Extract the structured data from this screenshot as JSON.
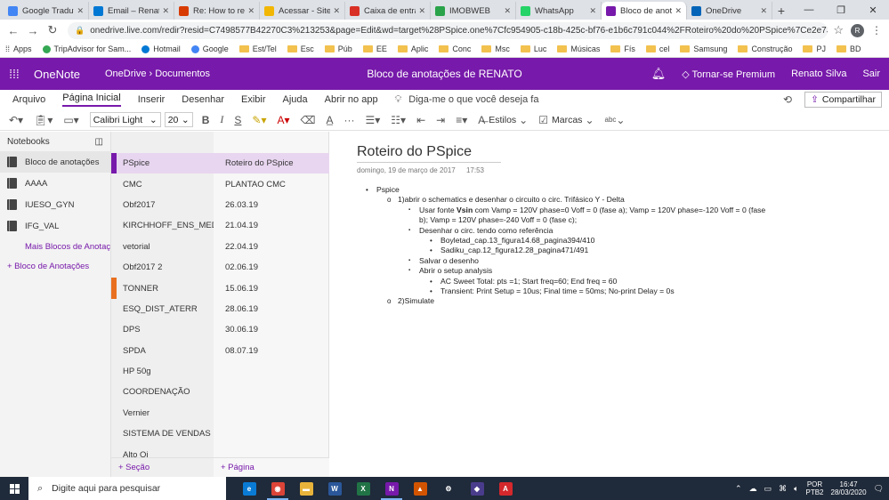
{
  "browser": {
    "tabs": [
      {
        "title": "Google Tradutor",
        "color": "#4285f4",
        "active": false
      },
      {
        "title": "Email – Renato",
        "color": "#0078d4",
        "active": false
      },
      {
        "title": "Re: How to recu",
        "color": "#d83b01",
        "active": false
      },
      {
        "title": "Acessar - Site c",
        "color": "#f2b705",
        "active": false
      },
      {
        "title": "Caixa de entrad",
        "color": "#d93025",
        "active": false
      },
      {
        "title": "IMOBWEB",
        "color": "#2aa34a",
        "active": false
      },
      {
        "title": "WhatsApp",
        "color": "#25d366",
        "active": false
      },
      {
        "title": "Bloco de anotaç",
        "color": "#7719aa",
        "active": true
      },
      {
        "title": "OneDrive",
        "color": "#0364b8",
        "active": false
      }
    ],
    "url": "onedrive.live.com/redir?resid=C7498577B42270C3%213253&page=Edit&wd=target%28PSpice.one%7Cfc954905-c18b-425c-bf76-e1b6c791c044%2FRoteiro%20do%20PSpice%7Ce2e7392d-4cba...",
    "profile_initial": "R",
    "bookmarks": [
      {
        "label": "Apps",
        "type": "apps"
      },
      {
        "label": "TripAdvisor for Sam...",
        "type": "site",
        "color": "#34a853"
      },
      {
        "label": "Hotmail",
        "type": "site",
        "color": "#0078d4"
      },
      {
        "label": "Google",
        "type": "site",
        "color": "#4285f4"
      },
      {
        "label": "Est/Tel",
        "type": "folder"
      },
      {
        "label": "Esc",
        "type": "folder"
      },
      {
        "label": "Púb",
        "type": "folder"
      },
      {
        "label": "EE",
        "type": "folder"
      },
      {
        "label": "Aplic",
        "type": "folder"
      },
      {
        "label": "Conc",
        "type": "folder"
      },
      {
        "label": "Msc",
        "type": "folder"
      },
      {
        "label": "Luc",
        "type": "folder"
      },
      {
        "label": "Músicas",
        "type": "folder"
      },
      {
        "label": "Fís",
        "type": "folder"
      },
      {
        "label": "cel",
        "type": "folder"
      },
      {
        "label": "Samsung",
        "type": "folder"
      },
      {
        "label": "Construção",
        "type": "folder"
      },
      {
        "label": "PJ",
        "type": "folder"
      },
      {
        "label": "BD",
        "type": "folder"
      }
    ]
  },
  "onenote": {
    "app_name": "OneNote",
    "breadcrumb": "OneDrive › Documentos",
    "notebook_title": "Bloco de anotações de RENATO",
    "premium": "Tornar-se Premium",
    "user": "Renato Silva",
    "signout": "Sair",
    "ribbon_tabs": [
      "Arquivo",
      "Página Inicial",
      "Inserir",
      "Desenhar",
      "Exibir",
      "Ajuda",
      "Abrir no app"
    ],
    "tellme": "Diga-me o que você deseja fa",
    "share": "Compartilhar",
    "font": "Calibri Light",
    "font_size": "20",
    "bold": "B",
    "italic": "I",
    "underline": "S",
    "styles": "Estilos",
    "tags": "Marcas",
    "spell": "abc"
  },
  "notebooks": {
    "header": "Notebooks",
    "items": [
      "Bloco de anotações",
      "AAAA",
      "IUESO_GYN",
      "IFG_VAL"
    ],
    "more": "Mais Blocos de Anotaç",
    "add": "+ Bloco de Anotações"
  },
  "sections": {
    "items": [
      {
        "label": "PSpice",
        "color": "#7719aa",
        "selected": true
      },
      {
        "label": "CMC",
        "color": "",
        "selected": false
      },
      {
        "label": "Obf2017",
        "color": "",
        "selected": false
      },
      {
        "label": "KIRCHHOFF_ENS_MED...",
        "color": "",
        "selected": false
      },
      {
        "label": "vetorial",
        "color": "",
        "selected": false
      },
      {
        "label": "Obf2017 2",
        "color": "",
        "selected": false
      },
      {
        "label": "TONNER",
        "color": "#e86f1f",
        "selected": false
      },
      {
        "label": "ESQ_DIST_ATERR",
        "color": "",
        "selected": false
      },
      {
        "label": "DPS",
        "color": "",
        "selected": false
      },
      {
        "label": "SPDA",
        "color": "",
        "selected": false
      },
      {
        "label": "HP 50g",
        "color": "",
        "selected": false
      },
      {
        "label": "COORDENAÇÃO",
        "color": "",
        "selected": false
      },
      {
        "label": "Vernier",
        "color": "",
        "selected": false
      },
      {
        "label": "SISTEMA DE VENDAS",
        "color": "",
        "selected": false
      },
      {
        "label": "Alto Oi",
        "color": "",
        "selected": false
      }
    ],
    "add": "+ Seção"
  },
  "pages": {
    "items": [
      {
        "label": "Roteiro do PSpice",
        "selected": true
      },
      {
        "label": "PLANTAO CMC",
        "selected": false
      },
      {
        "label": "26.03.19",
        "selected": false
      },
      {
        "label": "21.04.19",
        "selected": false
      },
      {
        "label": "22.04.19",
        "selected": false
      },
      {
        "label": "02.06.19",
        "selected": false
      },
      {
        "label": "15.06.19",
        "selected": false
      },
      {
        "label": "28.06.19",
        "selected": false
      },
      {
        "label": "30.06.19",
        "selected": false
      },
      {
        "label": "08.07.19",
        "selected": false
      }
    ],
    "add": "+ Página"
  },
  "page": {
    "title": "Roteiro do PSpice",
    "date": "domingo, 19 de março de 2017",
    "time": "17:53",
    "lines": [
      {
        "level": 0,
        "bullet": "•",
        "text": "Pspice"
      },
      {
        "level": 1,
        "bullet": "o",
        "text": "1)abrir o schematics e desenhar o circuito o circ. Trifásico Y - Delta"
      },
      {
        "level": 2,
        "bullet": "▪",
        "pre": "Usar fonte ",
        "bold": "Vsin",
        "text": " com Vamp = 120V phase=0  Voff = 0 (fase a); Vamp = 120V phase=-120  Voff = 0 (fase"
      },
      {
        "level": 2,
        "bullet": "",
        "text": "b); Vamp = 120V phase=-240  Voff = 0 (fase c);"
      },
      {
        "level": 2,
        "bullet": "▪",
        "text": "Desenhar o circ. tendo como referência"
      },
      {
        "level": 3,
        "bullet": "•",
        "text": "Boyletad_cap.13_figura14.68_pagina394/410"
      },
      {
        "level": 3,
        "bullet": "•",
        "text": "Sadiku_cap.12_figura12.28_pagina471/491"
      },
      {
        "level": 2,
        "bullet": "▪",
        "text": "Salvar o desenho"
      },
      {
        "level": 2,
        "bullet": "▪",
        "text": "Abrir o setup analysis"
      },
      {
        "level": 3,
        "bullet": "•",
        "text": " AC Sweet Total: pts =1; Start freq=60; End freq = 60"
      },
      {
        "level": 3,
        "bullet": "•",
        "text": "Transient: Print Setup = 10us; Final time = 50ms; No-print Delay = 0s"
      },
      {
        "level": 1,
        "bullet": "o",
        "text": "2)Simulate"
      }
    ]
  },
  "taskbar": {
    "search": "Digite aqui para pesquisar",
    "apps": [
      {
        "name": "edge",
        "letter": "e",
        "color": "#0a7bd5",
        "active": false
      },
      {
        "name": "chrome",
        "letter": "◉",
        "color": "#db4437",
        "active": true
      },
      {
        "name": "explorer",
        "letter": "▬",
        "color": "#e8b33a",
        "active": false
      },
      {
        "name": "word",
        "letter": "W",
        "color": "#2b579a",
        "active": false
      },
      {
        "name": "excel",
        "letter": "X",
        "color": "#217346",
        "active": false
      },
      {
        "name": "onenote",
        "letter": "N",
        "color": "#7719aa",
        "active": true
      },
      {
        "name": "matlab",
        "letter": "▲",
        "color": "#d35400",
        "active": false
      },
      {
        "name": "settings",
        "letter": "⚙",
        "color": "#1f2a3a",
        "active": false
      },
      {
        "name": "app",
        "letter": "◆",
        "color": "#4a3c8c",
        "active": false
      },
      {
        "name": "acrobat",
        "letter": "A",
        "color": "#d4282c",
        "active": false
      }
    ],
    "lang_top": "POR",
    "lang_bottom": "PTB2",
    "time": "16:47",
    "date": "28/03/2020"
  }
}
